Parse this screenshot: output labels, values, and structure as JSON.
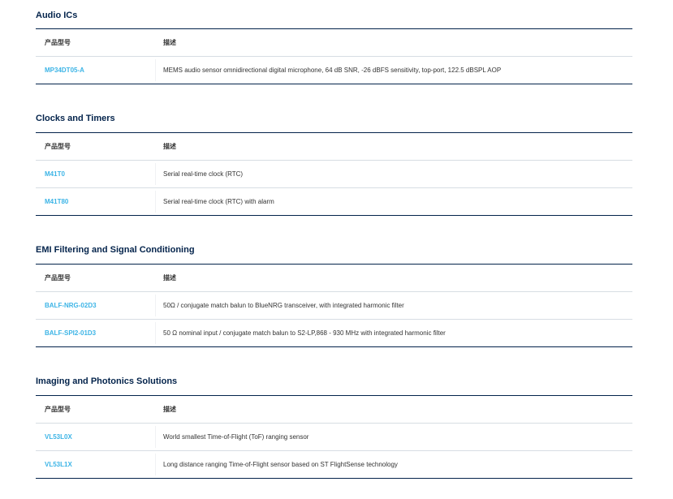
{
  "table_headers": {
    "part": "产品型号",
    "desc": "描述"
  },
  "sections": [
    {
      "title": "Audio ICs",
      "rows": [
        {
          "part": "MP34DT05-A",
          "desc": "MEMS audio sensor omnidirectional digital microphone, 64 dB SNR, -26 dBFS sensitivity, top-port, 122.5 dBSPL AOP"
        }
      ]
    },
    {
      "title": "Clocks and Timers",
      "rows": [
        {
          "part": "M41T0",
          "desc": "Serial real-time clock (RTC)"
        },
        {
          "part": "M41T80",
          "desc": "Serial real-time clock (RTC) with alarm"
        }
      ]
    },
    {
      "title": "EMI Filtering and Signal Conditioning",
      "rows": [
        {
          "part": "BALF-NRG-02D3",
          "desc": "50Ω / conjugate match balun to BlueNRG transceiver, with integrated harmonic filter"
        },
        {
          "part": "BALF-SPI2-01D3",
          "desc": "50 Ω nominal input / conjugate match balun to S2-LP,868 - 930 MHz with integrated harmonic filter"
        }
      ]
    },
    {
      "title": "Imaging and Photonics Solutions",
      "rows": [
        {
          "part": "VL53L0X",
          "desc": "World smallest Time-of-Flight (ToF) ranging sensor"
        },
        {
          "part": "VL53L1X",
          "desc": "Long distance ranging Time-of-Flight sensor based on ST FlightSense technology"
        }
      ]
    }
  ]
}
